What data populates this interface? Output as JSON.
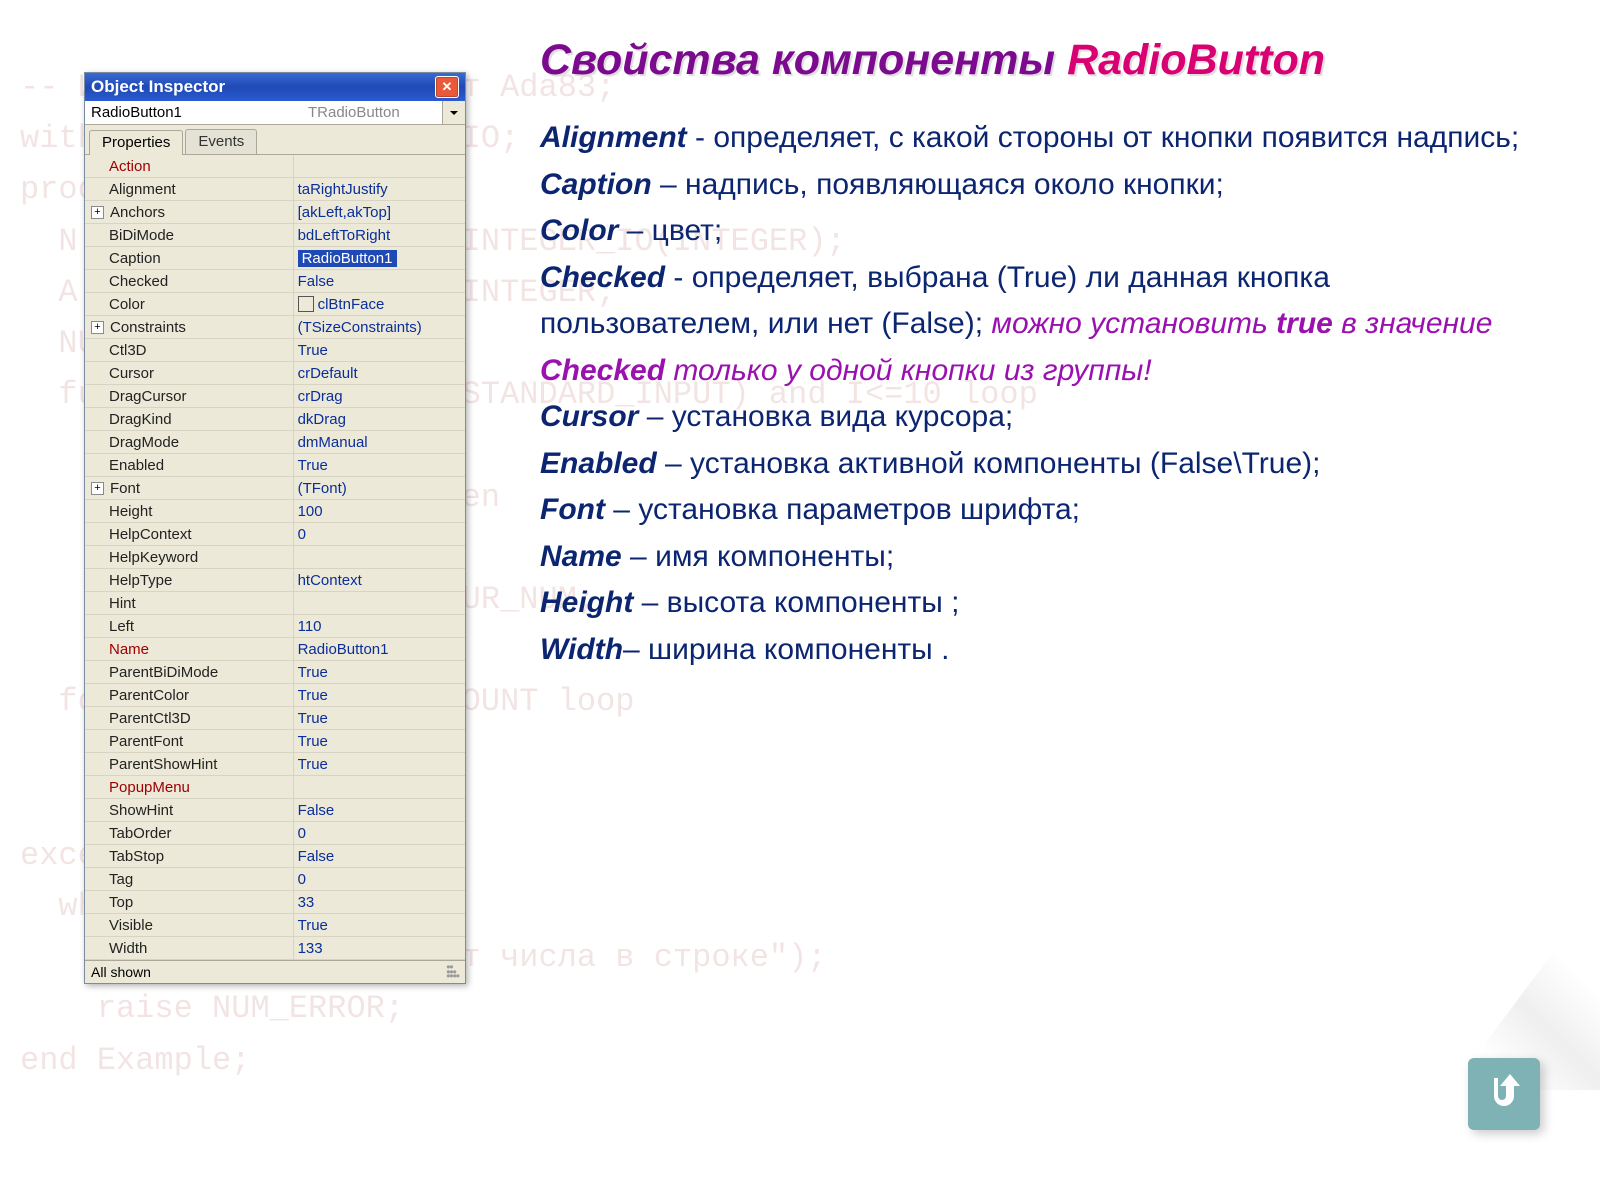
{
  "bg_code": "-- Используется стандарт Ada83;\nwith TEXT_IO; use TEXT_IO;\nprocedure Example is\n  N : INTEGER range 1..INTEGER_IO(INTEGER);\n  A : array (1..10) of INTEGER;\n  NUM, I : INTEGER;\n  function END_OF_FILE(STANDARD_INPUT) and I<=10 loop\n    GET(NUM);\n    if NUM mod 2 <>0 then\n      COUNT:=COUNT+1;\n      NUMBERS(COUNT):=CUR_NUM;\n    end if;\n  for I in reverse 1..COUNT loop\n    PUT(NUMBERS(I));\n\nexception\n  when DATA_ERROR =>\n    PUT(\"Неверный формат числа в строке\");\n    raise NUM_ERROR;\nend Example;",
  "inspector": {
    "title": "Object Inspector",
    "instance": "RadioButton1",
    "class": "TRadioButton",
    "tabs": {
      "properties": "Properties",
      "events": "Events"
    },
    "status": "All shown",
    "props": [
      {
        "name": "Action",
        "value": "",
        "red": true
      },
      {
        "name": "Alignment",
        "value": "taRightJustify"
      },
      {
        "name": "Anchors",
        "value": "[akLeft,akTop]",
        "expand": true
      },
      {
        "name": "BiDiMode",
        "value": "bdLeftToRight"
      },
      {
        "name": "Caption",
        "value": "RadioButton1",
        "selected": true
      },
      {
        "name": "Checked",
        "value": "False"
      },
      {
        "name": "Color",
        "value": "clBtnFace",
        "swatch": true
      },
      {
        "name": "Constraints",
        "value": "(TSizeConstraints)",
        "expand": true
      },
      {
        "name": "Ctl3D",
        "value": "True"
      },
      {
        "name": "Cursor",
        "value": "crDefault"
      },
      {
        "name": "DragCursor",
        "value": "crDrag"
      },
      {
        "name": "DragKind",
        "value": "dkDrag"
      },
      {
        "name": "DragMode",
        "value": "dmManual"
      },
      {
        "name": "Enabled",
        "value": "True"
      },
      {
        "name": "Font",
        "value": "(TFont)",
        "expand": true
      },
      {
        "name": "Height",
        "value": "100"
      },
      {
        "name": "HelpContext",
        "value": "0"
      },
      {
        "name": "HelpKeyword",
        "value": ""
      },
      {
        "name": "HelpType",
        "value": "htContext"
      },
      {
        "name": "Hint",
        "value": ""
      },
      {
        "name": "Left",
        "value": "110"
      },
      {
        "name": "Name",
        "value": "RadioButton1",
        "red": true
      },
      {
        "name": "ParentBiDiMode",
        "value": "True"
      },
      {
        "name": "ParentColor",
        "value": "True"
      },
      {
        "name": "ParentCtl3D",
        "value": "True"
      },
      {
        "name": "ParentFont",
        "value": "True"
      },
      {
        "name": "ParentShowHint",
        "value": "True"
      },
      {
        "name": "PopupMenu",
        "value": "",
        "red": true
      },
      {
        "name": "ShowHint",
        "value": "False"
      },
      {
        "name": "TabOrder",
        "value": "0"
      },
      {
        "name": "TabStop",
        "value": "False"
      },
      {
        "name": "Tag",
        "value": "0"
      },
      {
        "name": "Top",
        "value": "33"
      },
      {
        "name": "Visible",
        "value": "True"
      },
      {
        "name": "Width",
        "value": "133"
      }
    ]
  },
  "heading": {
    "prefix": "Свойства компоненты ",
    "comp": "RadioButton"
  },
  "descriptions": [
    {
      "term": "Alignment",
      "text": " - определяет, с какой стороны от кнопки появится надпись;"
    },
    {
      "term": "Caption",
      "text": " – надпись, появляющаяся около кнопки;"
    },
    {
      "term": "Color",
      "text": " – цвет;"
    },
    {
      "term": "Checked",
      "text": " - определяет, выбрана (True) ли данная кнопка пользователем, или нет (False); ",
      "note_pre": "можно установить ",
      "note_b1": "true",
      "note_mid": " в значение ",
      "note_b2": "Checked",
      "note_post": " только у одной кнопки из группы!"
    },
    {
      "term": "Cursor",
      "text": " – установка вида курсора;"
    },
    {
      "term": "Enabled",
      "text": " – установка активной компоненты (False\\True);"
    },
    {
      "term": "Font",
      "text": " – установка параметров шрифта;"
    },
    {
      "term": "Name",
      "text": " – имя компоненты;"
    },
    {
      "term": "Height",
      "text": " – высота компоненты ;"
    },
    {
      "term": "Width",
      "text": "– ширина компоненты ."
    }
  ]
}
